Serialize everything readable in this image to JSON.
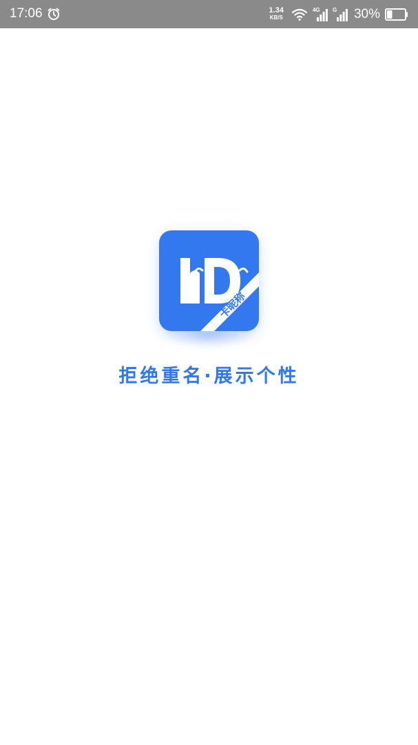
{
  "status_bar": {
    "time": "17:06",
    "net_speed_value": "1.34",
    "net_speed_unit": "KB/S",
    "sim1_tag": "4G",
    "sim2_tag": "G",
    "battery_percent": "30%",
    "battery_level": 0.3,
    "icons": [
      "alarm-icon",
      "wifi-icon",
      "signal-icon",
      "signal-icon",
      "battery-icon"
    ],
    "background_color": "#8a8a8a"
  },
  "splash": {
    "logo": {
      "letters": "hD",
      "ribbon_text": "卡昵称",
      "background_color": "#3478f0"
    },
    "slogan": "拒绝重名·展示个性",
    "accent_color": "#2f78f0"
  }
}
